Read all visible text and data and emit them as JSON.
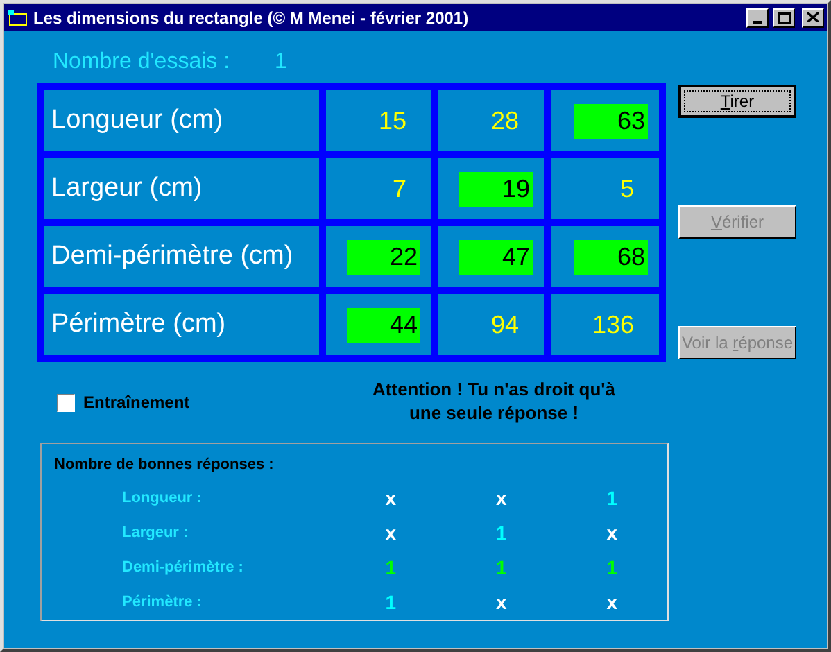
{
  "window": {
    "title": "Les dimensions du rectangle (© M Menei - février 2001)"
  },
  "attempts": {
    "label": "Nombre d'essais :",
    "value": "1"
  },
  "table": {
    "rows": [
      {
        "label": "Longueur (cm)",
        "cells": [
          {
            "value": "15",
            "given": false
          },
          {
            "value": "28",
            "given": false
          },
          {
            "value": "63",
            "given": true
          }
        ]
      },
      {
        "label": "Largeur (cm)",
        "cells": [
          {
            "value": "7",
            "given": false
          },
          {
            "value": "19",
            "given": true
          },
          {
            "value": "5",
            "given": false
          }
        ]
      },
      {
        "label": "Demi-périmètre (cm)",
        "cells": [
          {
            "value": "22",
            "given": true
          },
          {
            "value": "47",
            "given": true
          },
          {
            "value": "68",
            "given": true
          }
        ]
      },
      {
        "label": "Périmètre (cm)",
        "cells": [
          {
            "value": "44",
            "given": true
          },
          {
            "value": "94",
            "given": false
          },
          {
            "value": "136",
            "given": false
          }
        ]
      }
    ]
  },
  "buttons": [
    {
      "key": "T",
      "after": "irer",
      "default": true,
      "disabled": false
    },
    {
      "key": "V",
      "after": "érifier",
      "default": false,
      "disabled": true
    },
    {
      "before": "Voir la ",
      "key": "r",
      "after": "éponse",
      "default": false,
      "disabled": true
    }
  ],
  "training": {
    "label": "Entraînement",
    "checked": false
  },
  "warning": [
    "Attention ! Tu n'as droit qu'à",
    "une seule réponse !"
  ],
  "score": {
    "title": "Nombre de bonnes réponses :",
    "rows": [
      {
        "label": "Longueur :",
        "values": [
          {
            "text": "x",
            "color": "#ffffff"
          },
          {
            "text": "x",
            "color": "#ffffff"
          },
          {
            "text": "1",
            "color": "#00ffff"
          }
        ]
      },
      {
        "label": "Largeur :",
        "values": [
          {
            "text": "x",
            "color": "#ffffff"
          },
          {
            "text": "1",
            "color": "#00ffff"
          },
          {
            "text": "x",
            "color": "#ffffff"
          }
        ]
      },
      {
        "label": "Demi-périmètre :",
        "values": [
          {
            "text": "1",
            "color": "#00ff00"
          },
          {
            "text": "1",
            "color": "#00ff00"
          },
          {
            "text": "1",
            "color": "#00ff00"
          }
        ]
      },
      {
        "label": "Périmètre :",
        "values": [
          {
            "text": "1",
            "color": "#00ffff"
          },
          {
            "text": "x",
            "color": "#ffffff"
          },
          {
            "text": "x",
            "color": "#ffffff"
          }
        ]
      }
    ]
  }
}
